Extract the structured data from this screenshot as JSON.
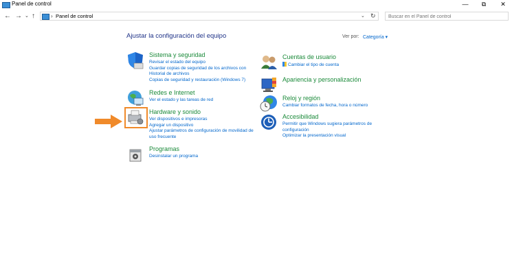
{
  "window": {
    "title": "Panel de control",
    "minimize": "—",
    "maximize": "⧉",
    "close": "✕"
  },
  "nav": {
    "back": "←",
    "forward": "→",
    "dropdown": "⌄",
    "up": "↑"
  },
  "address": {
    "separator": "›",
    "crumb": "Panel de control",
    "dropdown": "⌄",
    "refresh": "↻"
  },
  "search": {
    "placeholder": "Buscar en el Panel de control"
  },
  "main": {
    "heading": "Ajustar la configuración del equipo",
    "view_by_label": "Ver por:",
    "view_by_value": "Categoría ▾"
  },
  "categories": [
    {
      "title": "Sistema y seguridad",
      "links": [
        "Revisar el estado del equipo",
        "Guardar copias de seguridad de los archivos con",
        "Historial de archivos",
        "Copias de seguridad y restauración (Windows 7)"
      ]
    },
    {
      "title": "Redes e Internet",
      "links": [
        "Ver el estado y las tareas de red"
      ]
    },
    {
      "title": "Hardware y sonido",
      "links": [
        "Ver dispositivos e impresoras",
        "Agregar un dispositivo",
        "Ajustar parámetros de configuración de movilidad de",
        "uso frecuente"
      ]
    },
    {
      "title": "Programas",
      "links": [
        "Desinstalar un programa"
      ]
    },
    {
      "title": "Cuentas de usuario",
      "links": [
        "Cambiar el tipo de cuenta"
      ]
    },
    {
      "title": "Apariencia y personalización",
      "links": []
    },
    {
      "title": "Reloj y región",
      "links": [
        "Cambiar formatos de fecha, hora o número"
      ]
    },
    {
      "title": "Accesibilidad",
      "links": [
        "Permitir que Windows sugiera parámetros de",
        "configuración",
        "Optimizar la presentación visual"
      ]
    }
  ],
  "colors": {
    "accent_orange": "#f08a2a",
    "link_blue": "#0066cc",
    "category_green": "#1b8a3a",
    "heading_blue": "#1e3287"
  }
}
